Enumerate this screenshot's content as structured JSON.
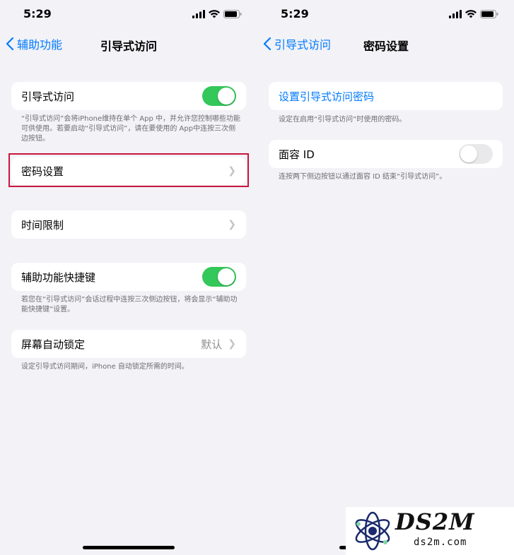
{
  "left": {
    "status_time": "5:29",
    "back_label": "辅助功能",
    "title": "引导式访问",
    "guided_access_label": "引导式访问",
    "guided_access_on": true,
    "guided_access_footer": "“引导式访问”会将iPhone维持在单个 App 中，并允许您控制哪些功能可供使用。若要启动“引导式访问”，请在要使用的 App中连按三次侧边按钮。",
    "passcode_settings_label": "密码设置",
    "time_limits_label": "时间限制",
    "shortcut_label": "辅助功能快捷键",
    "shortcut_on": true,
    "shortcut_footer": "若您在“引导式访问”会话过程中连按三次侧边按钮，将会显示“辅助功能快捷键”设置。",
    "auto_lock_label": "屏幕自动锁定",
    "auto_lock_value": "默认",
    "auto_lock_footer": "设定引导式访问期间，iPhone 自动锁定所需的时间。"
  },
  "right": {
    "status_time": "5:29",
    "back_label": "引导式访问",
    "title": "密码设置",
    "set_passcode_label": "设置引导式访问密码",
    "set_passcode_footer": "设定在启用“引导式访问”时使用的密码。",
    "face_id_label": "面容 ID",
    "face_id_on": false,
    "face_id_footer": "连按两下侧边按钮以通过面容 ID 结束“引导式访问”。"
  },
  "watermark": {
    "logo_text": "DS2M",
    "domain_text": "ds2m.com"
  },
  "colors": {
    "accent": "#007aff",
    "toggle_on": "#34c759",
    "highlight": "#c8163b"
  }
}
